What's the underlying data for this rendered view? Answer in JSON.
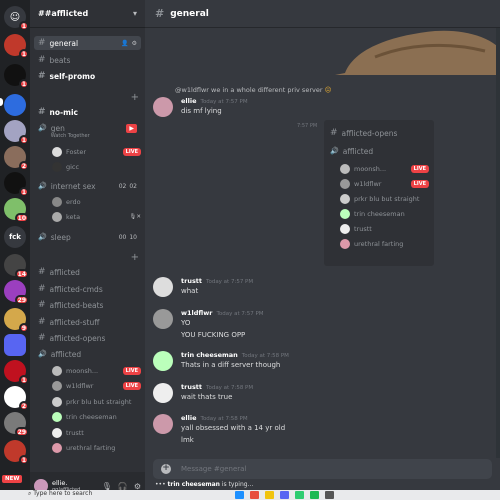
{
  "server": {
    "name": "##afflicted",
    "badges": [
      "1",
      "1",
      "1",
      "1",
      "2",
      "1",
      "1",
      "10",
      "1",
      "14",
      "29",
      "9",
      "1",
      "2",
      "29",
      "1",
      "1"
    ],
    "folder_label": "fck",
    "new_label": "NEW"
  },
  "sidebar": {
    "channels": {
      "general": "general",
      "beats": "beats",
      "self_promo": "self-promo",
      "no_mic": "no-mic",
      "gen": "gen",
      "gen_activity": "Watch Together",
      "foster": "Foster",
      "gicc": "gicc",
      "internet_sex": "internet sex",
      "internet_sex_counts": [
        "02",
        "02"
      ],
      "erdo": "erdo",
      "keta": "keta",
      "sleep": "sleep",
      "sleep_counts": [
        "00",
        "10"
      ],
      "afflicted": "afflicted",
      "afflicted_cmds": "afflicted-cmds",
      "afflicted_beats": "afflicted-beats",
      "afflicted_stuff": "afflicted-stuff",
      "afflicted_opens": "afflicted-opens",
      "afflicted_voice": "afflicted",
      "members": [
        "moonsh...",
        "w1ldflwr",
        "prkr blu but straight",
        "trin cheeseman",
        "trustt",
        "urethral farting"
      ]
    },
    "live": "LIVE",
    "user": {
      "name": "ellie.",
      "tag": "gg/afflicted"
    }
  },
  "chat": {
    "channel": "general",
    "reply": "@w1ldflwr we in a whole different priv server",
    "side_ts": "7:57 PM",
    "embed": {
      "title": "afflicted-opens",
      "voice": "afflicted",
      "members": [
        "moonsh...",
        "w1ldflwr",
        "prkr blu but straight",
        "trin cheeseman",
        "trustt",
        "urethral farting"
      ]
    },
    "messages": [
      {
        "name": "ellie",
        "ts": "Today at 7:57 PM",
        "lines": [
          "dis mf lying"
        ]
      },
      {
        "name": "trustt",
        "ts": "Today at 7:57 PM",
        "lines": [
          "what"
        ]
      },
      {
        "name": "w1ldflwr",
        "ts": "Today at 7:57 PM",
        "lines": [
          "YO",
          "YOU FUCKING OPP"
        ]
      },
      {
        "name": "trin cheeseman",
        "ts": "Today at 7:58 PM",
        "lines": [
          "Thats in a diff server though"
        ]
      },
      {
        "name": "trustt",
        "ts": "Today at 7:58 PM",
        "lines": [
          "wait thats true"
        ]
      },
      {
        "name": "ellie",
        "ts": "Today at 7:58 PM",
        "lines": [
          "yall obsessed with a 14 yr old",
          "lmk"
        ]
      }
    ],
    "input_placeholder": "Message #general",
    "typing_name": "trin cheeseman",
    "typing_suffix": " is typing..."
  },
  "taskbar": {
    "search": "Type here to search"
  },
  "colors": {
    "live": "#ed4245",
    "rail": "#202225",
    "sidebar": "#2f3136",
    "chat": "#36393f"
  }
}
